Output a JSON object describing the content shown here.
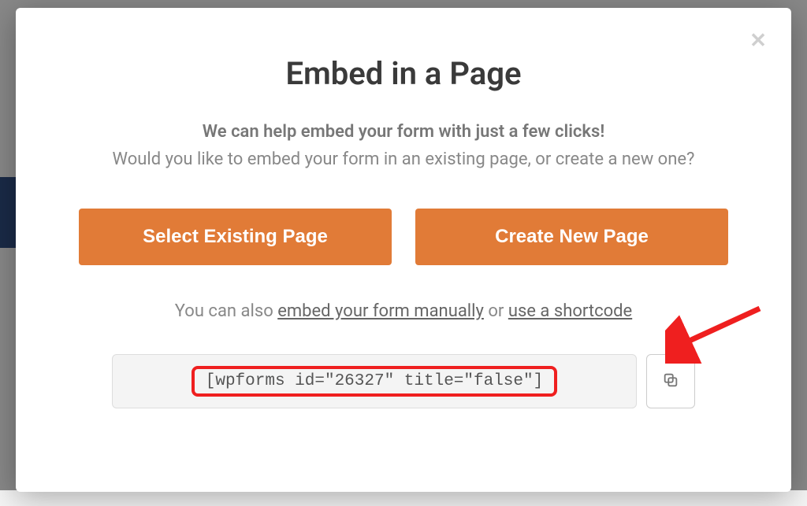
{
  "modal": {
    "title": "Embed in a Page",
    "subtitle_bold": "We can help embed your form with just a few clicks!",
    "subtitle_light": "Would you like to embed your form in an existing page, or create a new one?",
    "buttons": {
      "select_existing": "Select Existing Page",
      "create_new": "Create New Page"
    },
    "footer": {
      "prefix": "You can also ",
      "link_manual": "embed your form manually",
      "middle": " or ",
      "link_shortcode": "use a shortcode"
    },
    "shortcode": "[wpforms id=\"26327\" title=\"false\"]"
  }
}
